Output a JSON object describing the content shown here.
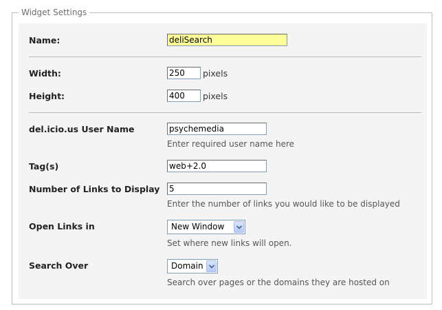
{
  "panel": {
    "legend": "Widget Settings"
  },
  "fields": {
    "name": {
      "label": "Name:",
      "value": "deliSearch"
    },
    "width": {
      "label": "Width:",
      "value": "250",
      "unit": "pixels"
    },
    "height": {
      "label": "Height:",
      "value": "400",
      "unit": "pixels"
    },
    "username": {
      "label": "del.icio.us User Name",
      "value": "psychemedia",
      "hint": "Enter required user name here"
    },
    "tags": {
      "label": "Tag(s)",
      "value": "web+2.0"
    },
    "num_links": {
      "label": "Number of Links to Display",
      "value": "5",
      "hint": "Enter the number of links you would like to be displayed"
    },
    "open_links": {
      "label": "Open Links in",
      "selected": "New Window",
      "hint": "Set where new links will open."
    },
    "search_over": {
      "label": "Search Over",
      "selected": "Domain",
      "hint": "Search over pages or the domains they are hosted on"
    }
  },
  "colors": {
    "highlight_input": "#ffff99",
    "panel_background": "#f4f4f4",
    "select_arrow": "#4d6185"
  },
  "icons": {
    "select_arrow": "chevron-down-icon"
  }
}
